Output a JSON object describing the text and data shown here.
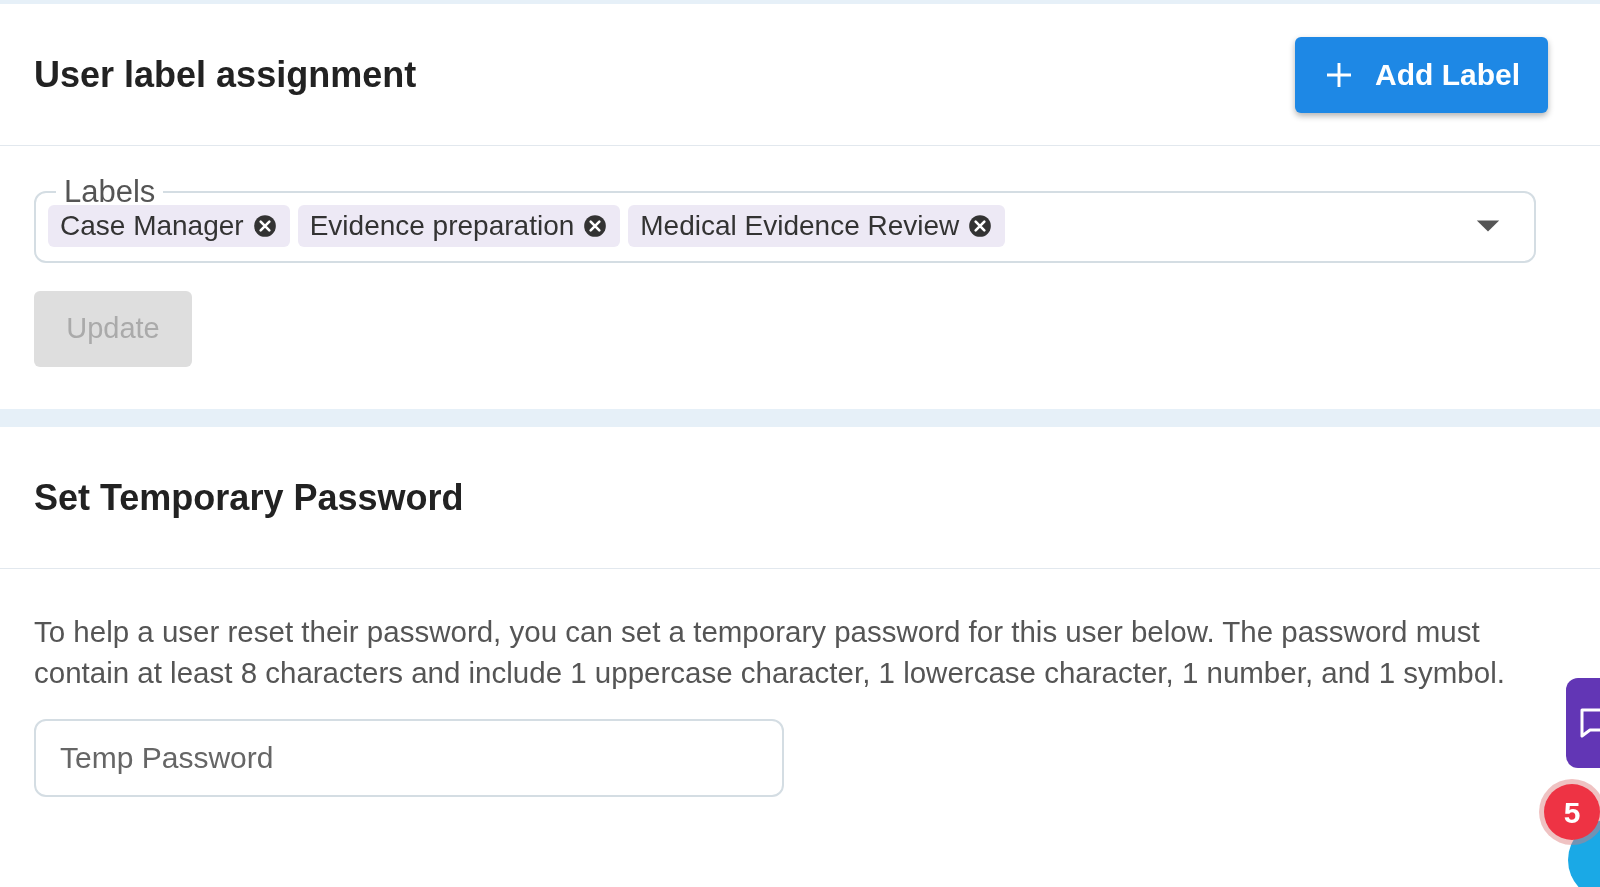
{
  "labels_card": {
    "title": "User label assignment",
    "add_button": "Add Label",
    "field": {
      "label": "Labels",
      "chips": [
        {
          "text": "Case Manager"
        },
        {
          "text": "Evidence preparation"
        },
        {
          "text": "Medical Evidence Review"
        }
      ]
    },
    "update_button": {
      "label": "Update",
      "disabled": true
    }
  },
  "password_card": {
    "title": "Set Temporary Password",
    "description": "To help a user reset their password, you can set a temporary password for this user below. The password must contain at least 8 characters and include 1 uppercase character, 1 lowercase character, 1 number, and 1 symbol.",
    "input": {
      "placeholder": "Temp Password"
    }
  },
  "notification_badge": {
    "count": "5"
  }
}
